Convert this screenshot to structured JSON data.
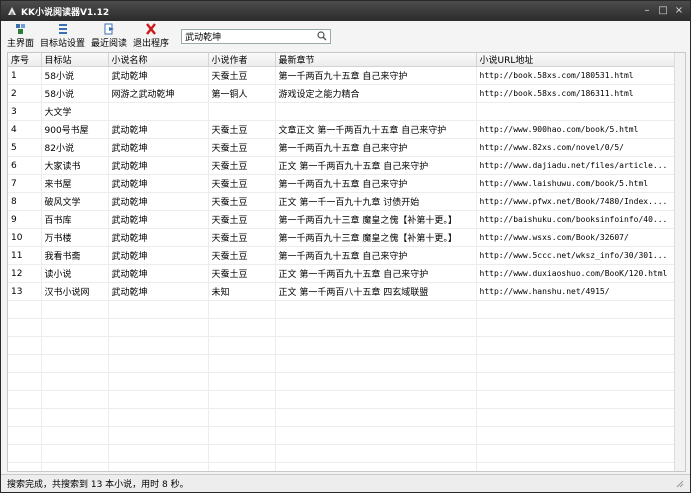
{
  "window": {
    "title": "KK小说阅读器V1.12"
  },
  "toolbar": {
    "buttons": [
      {
        "label": "主界面",
        "icon": "home-grid-icon"
      },
      {
        "label": "目标站设置",
        "icon": "list-settings-icon"
      },
      {
        "label": "最近阅读",
        "icon": "page-arrow-icon"
      },
      {
        "label": "退出程序",
        "icon": "red-x-icon"
      }
    ],
    "search_value": "武动乾坤"
  },
  "table": {
    "headers": [
      "序号",
      "目标站",
      "小说名称",
      "小说作者",
      "最新章节",
      "小说URL地址"
    ],
    "rows": [
      [
        "1",
        "58小说",
        "武动乾坤",
        "天蚕土豆",
        "第一千两百九十五章 自己来守护",
        "http://book.58xs.com/180531.html"
      ],
      [
        "2",
        "58小说",
        "网游之武动乾坤",
        "第一铜人",
        "游戏设定之能力精合",
        "http://book.58xs.com/186311.html"
      ],
      [
        "3",
        "大文学",
        "",
        "",
        "",
        ""
      ],
      [
        "4",
        "900号书屋",
        "武动乾坤",
        "天蚕土豆",
        "文章正文 第一千两百九十五章 自己来守护",
        "http://www.900hao.com/book/5.html"
      ],
      [
        "5",
        "82小说",
        "武动乾坤",
        "天蚕土豆",
        "第一千两百九十五章 自己来守护",
        "http://www.82xs.com/novel/0/5/"
      ],
      [
        "6",
        "大家读书",
        "武动乾坤",
        "天蚕土豆",
        "正文 第一千两百九十五章 自己来守护",
        "http://www.dajiadu.net/files/article..."
      ],
      [
        "7",
        "来书屋",
        "武动乾坤",
        "天蚕土豆",
        "第一千两百九十五章 自己来守护",
        "http://www.laishuwu.com/book/5.html"
      ],
      [
        "8",
        "破风文学",
        "武动乾坤",
        "天蚕土豆",
        "正文 第一千一百九十九章 讨债开始",
        "http://www.pfwx.net/Book/7480/Index...."
      ],
      [
        "9",
        "百书库",
        "武动乾坤",
        "天蚕土豆",
        "第一千两百九十三章 魔皇之傀【补第十更。】",
        "http://baishuku.com/booksinfoinfo/40..."
      ],
      [
        "10",
        "万书楼",
        "武动乾坤",
        "天蚕土豆",
        "第一千两百九十三章 魔皇之傀【补第十更。】",
        "http://www.wsxs.com/Book/32607/"
      ],
      [
        "11",
        "我看书斋",
        "武动乾坤",
        "天蚕土豆",
        "第一千两百九十五章 自己来守护",
        "http://www.5ccc.net/wksz_info/30/301..."
      ],
      [
        "12",
        "读小说",
        "武动乾坤",
        "天蚕土豆",
        "正文 第一千两百九十五章 自己来守护",
        "http://www.duxiaoshuo.com/BooK/120.html"
      ],
      [
        "13",
        "汉书小说网",
        "武动乾坤",
        "未知",
        "正文 第一千两百八十五章 四玄域联盟",
        "http://www.hanshu.net/4915/"
      ]
    ],
    "empty_rows": 11
  },
  "status": {
    "text": "搜索完成，共搜索到 13 本小说，用时 8 秒。"
  }
}
